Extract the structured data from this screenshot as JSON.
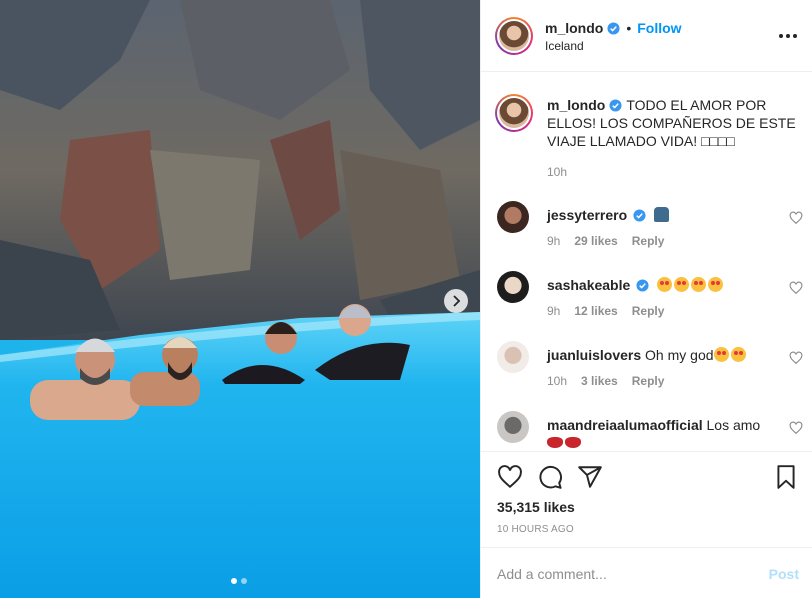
{
  "post": {
    "author": "m_londo",
    "location": "Iceland",
    "follow_label": "Follow",
    "separator": "•",
    "caption": "TODO EL AMOR POR ELLOS! LOS COMPAÑEROS DE ESTE VIAJE LLAMADO VIDA! □□□□",
    "caption_time": "10h",
    "likes": "35,315 likes",
    "posted": "10 HOURS AGO",
    "carousel": {
      "slides": 2,
      "current": 1
    }
  },
  "comments": [
    {
      "user": "jessyterrero",
      "verified": true,
      "text": "",
      "emojis": [
        "person"
      ],
      "time": "9h",
      "likes": "29 likes",
      "reply": "Reply"
    },
    {
      "user": "sashakeable",
      "verified": true,
      "text": "",
      "emojis": [
        "heart-eyes",
        "heart-eyes",
        "heart-eyes",
        "heart-eyes"
      ],
      "time": "9h",
      "likes": "12 likes",
      "reply": "Reply"
    },
    {
      "user": "juanluislovers",
      "verified": false,
      "text": "Oh my god",
      "emojis": [
        "heart-eyes",
        "heart-eyes"
      ],
      "time": "10h",
      "likes": "3 likes",
      "reply": "Reply"
    },
    {
      "user": "maandreiaalumaofficial",
      "verified": false,
      "text": "Los amo",
      "emojis": [
        "lips",
        "lips"
      ],
      "time": "",
      "likes": "",
      "reply": ""
    }
  ],
  "comment_box": {
    "placeholder": "Add a comment...",
    "post_label": "Post"
  },
  "colors": {
    "link_blue": "#0095f6",
    "muted": "#8e8e8e",
    "text": "#262626",
    "post_disabled": "#b2dffc",
    "pool": "#1fb3ec"
  },
  "icons": [
    "chevron-right-icon",
    "verified-badge-icon",
    "more-options-icon",
    "heart-icon",
    "comment-icon",
    "share-icon",
    "bookmark-icon"
  ]
}
